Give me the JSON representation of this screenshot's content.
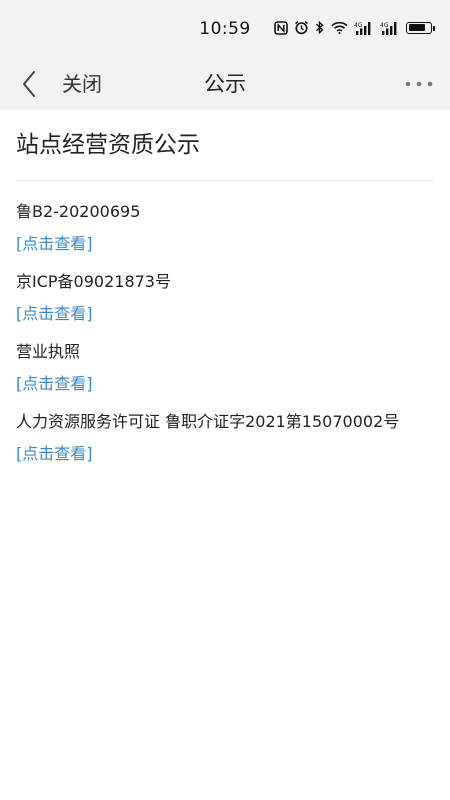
{
  "status_bar": {
    "time": "10:59",
    "battery_level": 0.85
  },
  "nav": {
    "close_label": "关闭",
    "title": "公示"
  },
  "page": {
    "title": "站点经营资质公示"
  },
  "items": [
    {
      "text": "鲁B2-20200695",
      "link": "[点击查看]"
    },
    {
      "text": "京ICP备09021873号",
      "link": "[点击查看]"
    },
    {
      "text": "营业执照",
      "link": "[点击查看]"
    },
    {
      "text": "人力资源服务许可证 鲁职介证字2021第15070002号",
      "link": "[点击查看]"
    }
  ],
  "colors": {
    "link": "#3c89c9",
    "bar_background": "#f2f2f2"
  }
}
